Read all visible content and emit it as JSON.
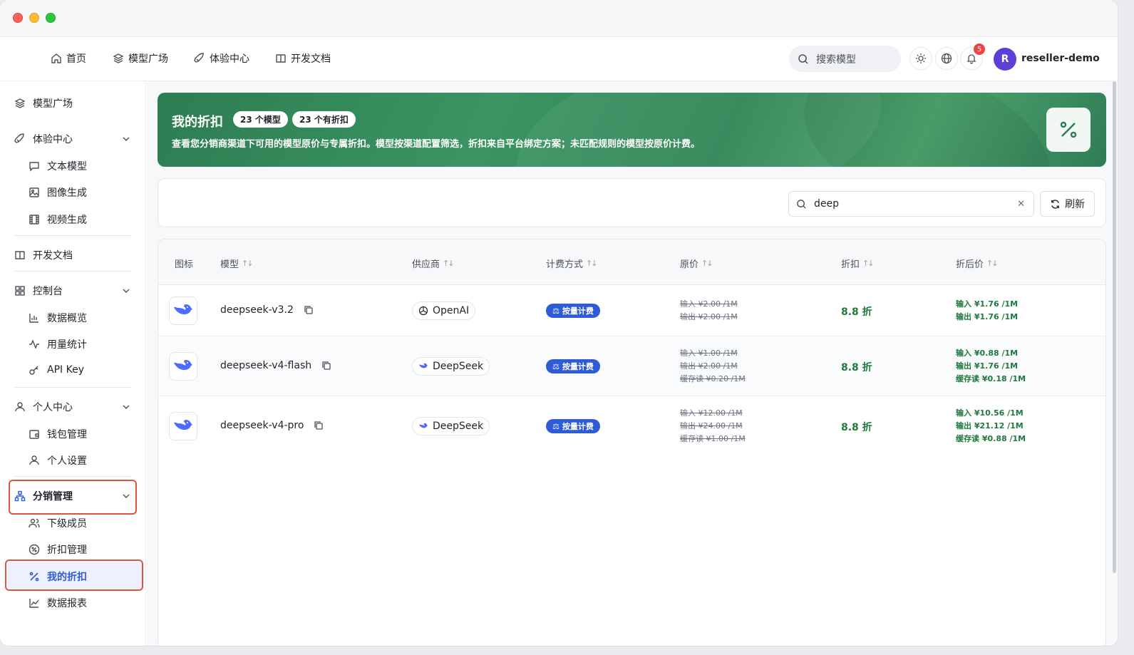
{
  "topnav": {
    "items": [
      {
        "label": "首页",
        "icon": "home-icon"
      },
      {
        "label": "模型广场",
        "icon": "layers-icon"
      },
      {
        "label": "体验中心",
        "icon": "rocket-icon"
      },
      {
        "label": "开发文档",
        "icon": "book-icon"
      }
    ],
    "search_placeholder": "搜索模型",
    "notification_count": "5",
    "avatar_initial": "R",
    "username": "reseller-demo"
  },
  "sidebar": {
    "model_square": "模型广场",
    "experience": "体验中心",
    "text_model": "文本模型",
    "image_gen": "图像生成",
    "video_gen": "视频生成",
    "dev_docs": "开发文档",
    "console": "控制台",
    "data_overview": "数据概览",
    "usage_stats": "用量统计",
    "api_key": "API Key",
    "personal_center": "个人中心",
    "wallet": "钱包管理",
    "personal_settings": "个人设置",
    "distribution": "分销管理",
    "sub_members": "下级成员",
    "discount_mgmt": "折扣管理",
    "my_discount": "我的折扣",
    "data_report": "数据报表"
  },
  "annotations": {
    "one": "①",
    "two": "②",
    "color": "#e0533d"
  },
  "banner": {
    "title": "我的折扣",
    "pill_models": "23 个模型",
    "pill_discounts": "23 个有折扣",
    "description": "查看您分销商渠道下可用的模型原价与专属折扣。模型按渠道配置筛选，折扣来自平台绑定方案；未匹配规则的模型按原价计费。"
  },
  "filter": {
    "search_value": "deep",
    "refresh_label": "刷新"
  },
  "table": {
    "headers": {
      "icon": "图标",
      "model": "模型",
      "vendor": "供应商",
      "billing": "计费方式",
      "original": "原价",
      "discount": "折扣",
      "final": "折后价"
    },
    "rows": [
      {
        "model": "deepseek-v3.2",
        "vendor": "OpenAI",
        "billing": "按量计费",
        "original": [
          "输入 ¥2.00 /1M",
          "输出 ¥2.00 /1M"
        ],
        "discount": "8.8 折",
        "final": [
          "输入 ¥1.76 /1M",
          "输出 ¥1.76 /1M"
        ]
      },
      {
        "model": "deepseek-v4-flash",
        "vendor": "DeepSeek",
        "billing": "按量计费",
        "original": [
          "输入 ¥1.00 /1M",
          "输出 ¥2.00 /1M",
          "缓存读 ¥0.20 /1M"
        ],
        "discount": "8.8 折",
        "final": [
          "输入 ¥0.88 /1M",
          "输出 ¥1.76 /1M",
          "缓存读 ¥0.18 /1M"
        ]
      },
      {
        "model": "deepseek-v4-pro",
        "vendor": "DeepSeek",
        "billing": "按量计费",
        "original": [
          "输入 ¥12.00 /1M",
          "输出 ¥24.00 /1M",
          "缓存读 ¥1.00 /1M"
        ],
        "discount": "8.8 折",
        "final": [
          "输入 ¥10.56 /1M",
          "输出 ¥21.12 /1M",
          "缓存读 ¥0.88 /1M"
        ]
      }
    ]
  },
  "colors": {
    "accent": "#2f5bd6",
    "banner_green": "#3b9462",
    "discount_green": "#1f7a3d",
    "badge_red": "#ef4444"
  }
}
